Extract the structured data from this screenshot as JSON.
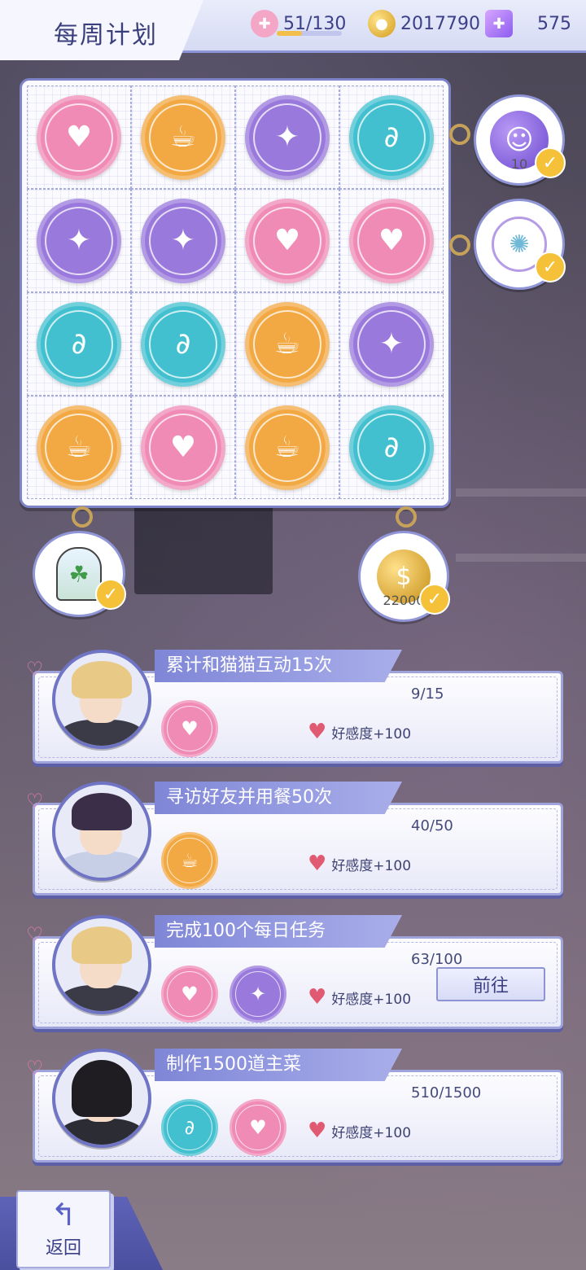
{
  "header": {
    "title": "每周计划",
    "stamina": "51/130",
    "stamina_fraction": 0.39,
    "gold": "2017790",
    "gems": "575"
  },
  "board": {
    "stamps": [
      [
        "cupcake",
        "coffee",
        "compass",
        "swan"
      ],
      [
        "compass",
        "compass",
        "cupcake",
        "cupcake"
      ],
      [
        "swan",
        "swan",
        "coffee",
        "compass"
      ],
      [
        "coffee",
        "cupcake",
        "coffee",
        "swan"
      ]
    ],
    "stamp_colors": {
      "cupcake": "#f08bb5",
      "coffee": "#f2a944",
      "compass": "#9a79dc",
      "swan": "#42c0cf"
    }
  },
  "rewards": {
    "row1_amount": "10",
    "col4_amount": "22000"
  },
  "tasks": [
    {
      "title": "累计和猫猫互动15次",
      "progress": "9/15",
      "stamps": [
        "cupcake"
      ],
      "favor": "好感度+100",
      "character": "blonde"
    },
    {
      "title": "寻访好友并用餐50次",
      "progress": "40/50",
      "stamps": [
        "coffee"
      ],
      "favor": "好感度+100",
      "character": "darkhair"
    },
    {
      "title": "完成100个每日任务",
      "progress": "63/100",
      "stamps": [
        "cupcake",
        "compass"
      ],
      "favor": "好感度+100",
      "character": "blonde",
      "button": "前往"
    },
    {
      "title": "制作1500道主菜",
      "progress": "510/1500",
      "stamps": [
        "swan",
        "cupcake"
      ],
      "favor": "好感度+100",
      "character": "longhair"
    }
  ],
  "footer": {
    "back_label": "返回"
  }
}
